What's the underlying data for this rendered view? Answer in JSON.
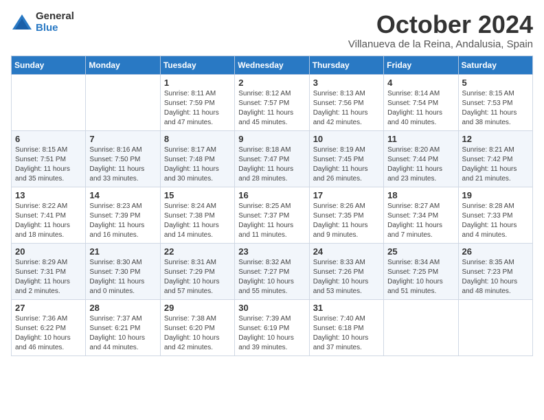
{
  "logo": {
    "text_general": "General",
    "text_blue": "Blue"
  },
  "title": "October 2024",
  "location": "Villanueva de la Reina, Andalusia, Spain",
  "weekdays": [
    "Sunday",
    "Monday",
    "Tuesday",
    "Wednesday",
    "Thursday",
    "Friday",
    "Saturday"
  ],
  "weeks": [
    [
      {
        "day": "",
        "sunrise": "",
        "sunset": "",
        "daylight": ""
      },
      {
        "day": "",
        "sunrise": "",
        "sunset": "",
        "daylight": ""
      },
      {
        "day": "1",
        "sunrise": "Sunrise: 8:11 AM",
        "sunset": "Sunset: 7:59 PM",
        "daylight": "Daylight: 11 hours and 47 minutes."
      },
      {
        "day": "2",
        "sunrise": "Sunrise: 8:12 AM",
        "sunset": "Sunset: 7:57 PM",
        "daylight": "Daylight: 11 hours and 45 minutes."
      },
      {
        "day": "3",
        "sunrise": "Sunrise: 8:13 AM",
        "sunset": "Sunset: 7:56 PM",
        "daylight": "Daylight: 11 hours and 42 minutes."
      },
      {
        "day": "4",
        "sunrise": "Sunrise: 8:14 AM",
        "sunset": "Sunset: 7:54 PM",
        "daylight": "Daylight: 11 hours and 40 minutes."
      },
      {
        "day": "5",
        "sunrise": "Sunrise: 8:15 AM",
        "sunset": "Sunset: 7:53 PM",
        "daylight": "Daylight: 11 hours and 38 minutes."
      }
    ],
    [
      {
        "day": "6",
        "sunrise": "Sunrise: 8:15 AM",
        "sunset": "Sunset: 7:51 PM",
        "daylight": "Daylight: 11 hours and 35 minutes."
      },
      {
        "day": "7",
        "sunrise": "Sunrise: 8:16 AM",
        "sunset": "Sunset: 7:50 PM",
        "daylight": "Daylight: 11 hours and 33 minutes."
      },
      {
        "day": "8",
        "sunrise": "Sunrise: 8:17 AM",
        "sunset": "Sunset: 7:48 PM",
        "daylight": "Daylight: 11 hours and 30 minutes."
      },
      {
        "day": "9",
        "sunrise": "Sunrise: 8:18 AM",
        "sunset": "Sunset: 7:47 PM",
        "daylight": "Daylight: 11 hours and 28 minutes."
      },
      {
        "day": "10",
        "sunrise": "Sunrise: 8:19 AM",
        "sunset": "Sunset: 7:45 PM",
        "daylight": "Daylight: 11 hours and 26 minutes."
      },
      {
        "day": "11",
        "sunrise": "Sunrise: 8:20 AM",
        "sunset": "Sunset: 7:44 PM",
        "daylight": "Daylight: 11 hours and 23 minutes."
      },
      {
        "day": "12",
        "sunrise": "Sunrise: 8:21 AM",
        "sunset": "Sunset: 7:42 PM",
        "daylight": "Daylight: 11 hours and 21 minutes."
      }
    ],
    [
      {
        "day": "13",
        "sunrise": "Sunrise: 8:22 AM",
        "sunset": "Sunset: 7:41 PM",
        "daylight": "Daylight: 11 hours and 18 minutes."
      },
      {
        "day": "14",
        "sunrise": "Sunrise: 8:23 AM",
        "sunset": "Sunset: 7:39 PM",
        "daylight": "Daylight: 11 hours and 16 minutes."
      },
      {
        "day": "15",
        "sunrise": "Sunrise: 8:24 AM",
        "sunset": "Sunset: 7:38 PM",
        "daylight": "Daylight: 11 hours and 14 minutes."
      },
      {
        "day": "16",
        "sunrise": "Sunrise: 8:25 AM",
        "sunset": "Sunset: 7:37 PM",
        "daylight": "Daylight: 11 hours and 11 minutes."
      },
      {
        "day": "17",
        "sunrise": "Sunrise: 8:26 AM",
        "sunset": "Sunset: 7:35 PM",
        "daylight": "Daylight: 11 hours and 9 minutes."
      },
      {
        "day": "18",
        "sunrise": "Sunrise: 8:27 AM",
        "sunset": "Sunset: 7:34 PM",
        "daylight": "Daylight: 11 hours and 7 minutes."
      },
      {
        "day": "19",
        "sunrise": "Sunrise: 8:28 AM",
        "sunset": "Sunset: 7:33 PM",
        "daylight": "Daylight: 11 hours and 4 minutes."
      }
    ],
    [
      {
        "day": "20",
        "sunrise": "Sunrise: 8:29 AM",
        "sunset": "Sunset: 7:31 PM",
        "daylight": "Daylight: 11 hours and 2 minutes."
      },
      {
        "day": "21",
        "sunrise": "Sunrise: 8:30 AM",
        "sunset": "Sunset: 7:30 PM",
        "daylight": "Daylight: 11 hours and 0 minutes."
      },
      {
        "day": "22",
        "sunrise": "Sunrise: 8:31 AM",
        "sunset": "Sunset: 7:29 PM",
        "daylight": "Daylight: 10 hours and 57 minutes."
      },
      {
        "day": "23",
        "sunrise": "Sunrise: 8:32 AM",
        "sunset": "Sunset: 7:27 PM",
        "daylight": "Daylight: 10 hours and 55 minutes."
      },
      {
        "day": "24",
        "sunrise": "Sunrise: 8:33 AM",
        "sunset": "Sunset: 7:26 PM",
        "daylight": "Daylight: 10 hours and 53 minutes."
      },
      {
        "day": "25",
        "sunrise": "Sunrise: 8:34 AM",
        "sunset": "Sunset: 7:25 PM",
        "daylight": "Daylight: 10 hours and 51 minutes."
      },
      {
        "day": "26",
        "sunrise": "Sunrise: 8:35 AM",
        "sunset": "Sunset: 7:23 PM",
        "daylight": "Daylight: 10 hours and 48 minutes."
      }
    ],
    [
      {
        "day": "27",
        "sunrise": "Sunrise: 7:36 AM",
        "sunset": "Sunset: 6:22 PM",
        "daylight": "Daylight: 10 hours and 46 minutes."
      },
      {
        "day": "28",
        "sunrise": "Sunrise: 7:37 AM",
        "sunset": "Sunset: 6:21 PM",
        "daylight": "Daylight: 10 hours and 44 minutes."
      },
      {
        "day": "29",
        "sunrise": "Sunrise: 7:38 AM",
        "sunset": "Sunset: 6:20 PM",
        "daylight": "Daylight: 10 hours and 42 minutes."
      },
      {
        "day": "30",
        "sunrise": "Sunrise: 7:39 AM",
        "sunset": "Sunset: 6:19 PM",
        "daylight": "Daylight: 10 hours and 39 minutes."
      },
      {
        "day": "31",
        "sunrise": "Sunrise: 7:40 AM",
        "sunset": "Sunset: 6:18 PM",
        "daylight": "Daylight: 10 hours and 37 minutes."
      },
      {
        "day": "",
        "sunrise": "",
        "sunset": "",
        "daylight": ""
      },
      {
        "day": "",
        "sunrise": "",
        "sunset": "",
        "daylight": ""
      }
    ]
  ]
}
